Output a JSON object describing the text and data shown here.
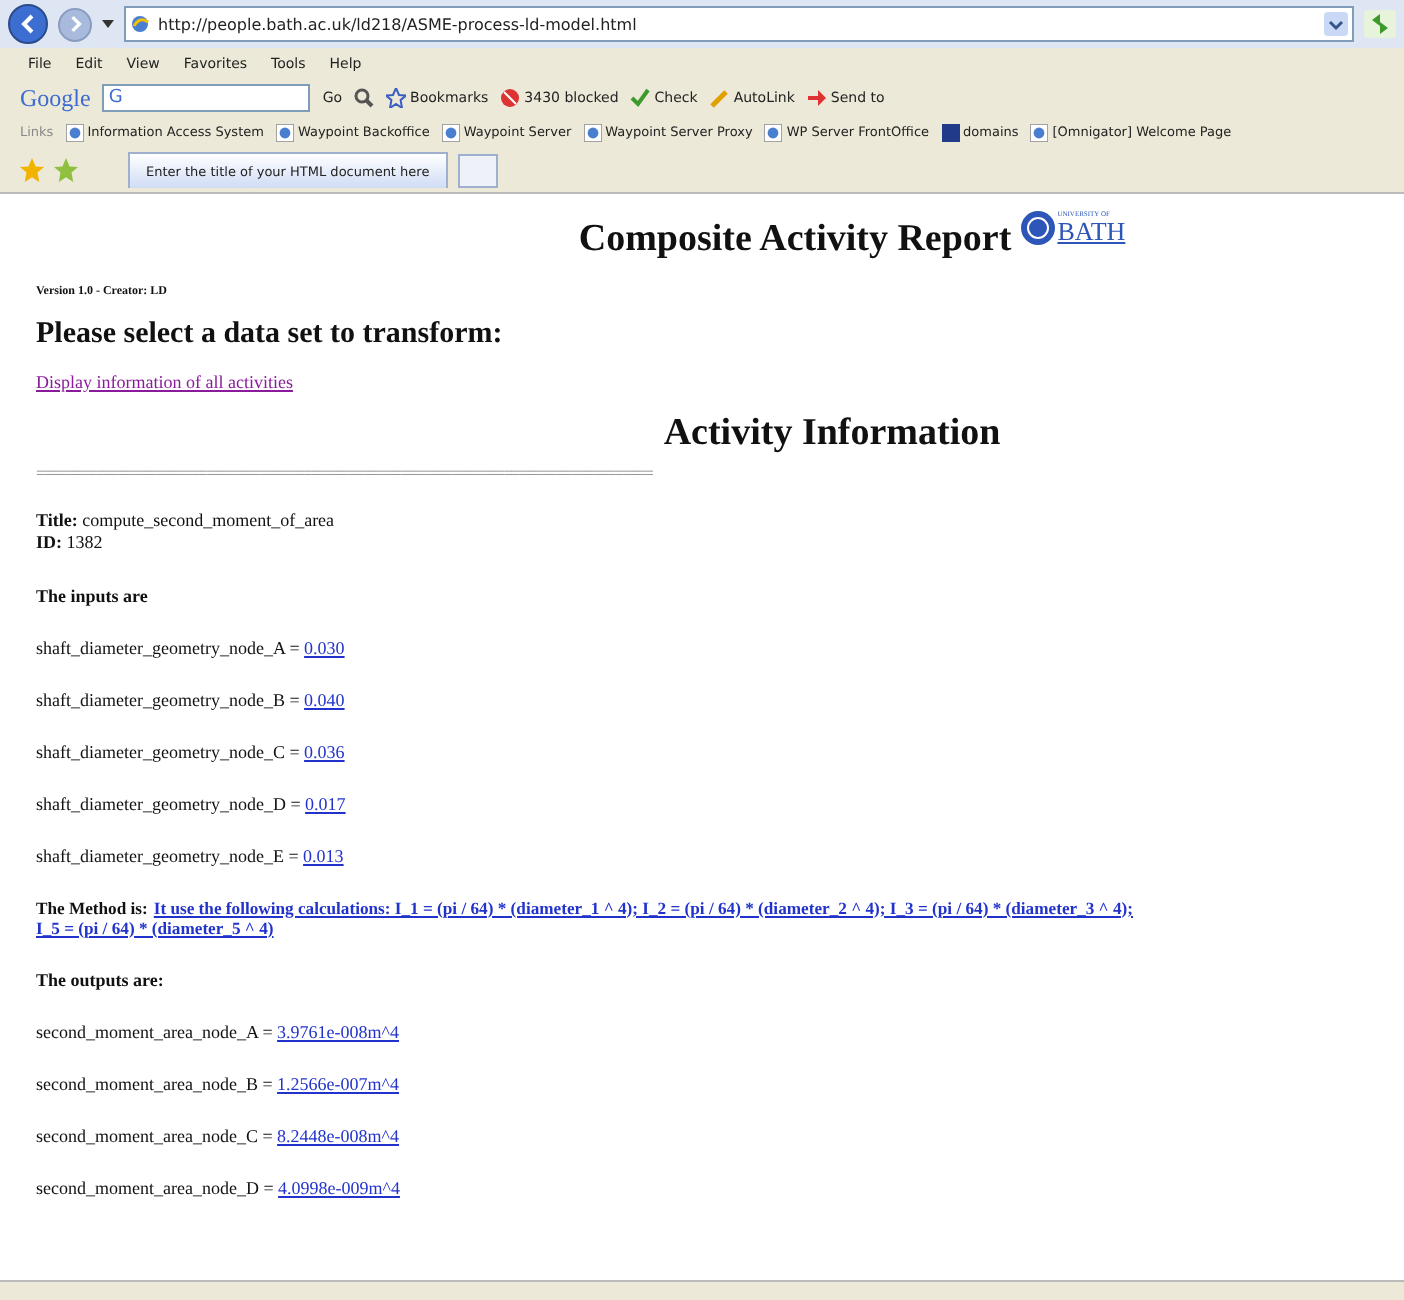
{
  "browser": {
    "address": "http://people.bath.ac.uk/ld218/ASME-process-ld-model.html",
    "menu": [
      "File",
      "Edit",
      "View",
      "Favorites",
      "Tools",
      "Help"
    ],
    "google_toolbar": {
      "logo": "Google",
      "search_prefix": "G",
      "go": "Go",
      "items": [
        {
          "kind": "bookmarks",
          "label": "Bookmarks"
        },
        {
          "kind": "blocked",
          "label": "3430 blocked"
        },
        {
          "kind": "check",
          "label": "Check"
        },
        {
          "kind": "autolink",
          "label": "AutoLink"
        },
        {
          "kind": "sendto",
          "label": "Send to"
        }
      ]
    },
    "links": {
      "label": "Links",
      "items": [
        {
          "kind": "page",
          "label": "Information Access System"
        },
        {
          "kind": "page",
          "label": "Waypoint Backoffice"
        },
        {
          "kind": "page",
          "label": "Waypoint Server"
        },
        {
          "kind": "page",
          "label": "Waypoint Server Proxy"
        },
        {
          "kind": "page",
          "label": "WP Server FrontOffice"
        },
        {
          "kind": "site",
          "label": "domains"
        },
        {
          "kind": "page",
          "label": "[Omnigator] Welcome Page"
        }
      ]
    },
    "tabs": [
      {
        "label": "Enter the title of your HTML document here",
        "selected": true
      }
    ]
  },
  "page": {
    "title": "Composite Activity Report",
    "logo": {
      "small": "UNIVERSITY OF",
      "name": "BATH"
    },
    "version": "Version 1.0 - Creator: LD",
    "prompt": "Please select a data set to transform:",
    "link": "Display information of all activities",
    "section_title": "Activity Information",
    "separator": "===================================================================================",
    "fields": [
      {
        "label": "Title:",
        "value": "compute_second_moment_of_area"
      },
      {
        "label": "ID:",
        "value": "1382"
      }
    ],
    "inputs_heading": "The inputs are",
    "inputs": [
      {
        "name": "shaft_diameter_geometry_node_A =",
        "value": "0.030"
      },
      {
        "name": "shaft_diameter_geometry_node_B =",
        "value": "0.040"
      },
      {
        "name": "shaft_diameter_geometry_node_C =",
        "value": "0.036"
      },
      {
        "name": "shaft_diameter_geometry_node_D =",
        "value": "0.017"
      },
      {
        "name": "shaft_diameter_geometry_node_E =",
        "value": "0.013"
      }
    ],
    "method": {
      "label": "The Method is:",
      "lines": [
        "It use the following calculations: I_1 = (pi / 64) * (diameter_1 ^ 4); I_2 = (pi / 64) * (diameter_2 ^ 4); I_3 = (pi / 64) * (diameter_3 ^ 4);",
        "I_5 = (pi / 64) * (diameter_5 ^ 4)"
      ]
    },
    "outputs_heading": "The outputs are:",
    "outputs": [
      {
        "name": "second_moment_area_node_A =",
        "value": "3.9761e-008m^4"
      },
      {
        "name": "second_moment_area_node_B =",
        "value": "1.2566e-007m^4"
      },
      {
        "name": "second_moment_area_node_C =",
        "value": "8.2448e-008m^4"
      },
      {
        "name": "second_moment_area_node_D =",
        "value": "4.0998e-009m^4"
      }
    ]
  }
}
